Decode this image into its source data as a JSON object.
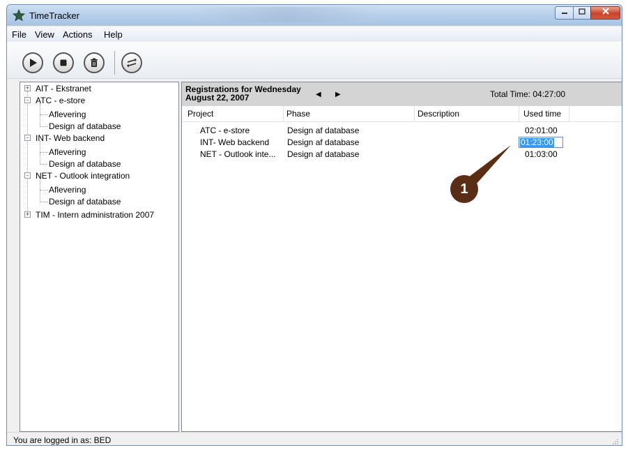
{
  "window": {
    "title": "TimeTracker"
  },
  "menu": [
    {
      "label": "File"
    },
    {
      "label": "View"
    },
    {
      "label": "Actions"
    },
    {
      "label": "Help"
    }
  ],
  "toolbar": {
    "icons": [
      "play-icon",
      "stop-icon",
      "trash-icon",
      "swap-arrows-icon"
    ]
  },
  "tree": {
    "items": [
      {
        "label": "AIT  - Ekstranet",
        "level": 0,
        "expander": "+"
      },
      {
        "label": "ATC - e-store",
        "level": 0,
        "expander": "-"
      },
      {
        "label": "Aflevering",
        "level": 1
      },
      {
        "label": "Design af database",
        "level": 1
      },
      {
        "label": "INT- Web backend",
        "level": 0,
        "expander": "-"
      },
      {
        "label": "Aflevering",
        "level": 1
      },
      {
        "label": "Design af database",
        "level": 1
      },
      {
        "label": "NET - Outlook integration",
        "level": 0,
        "expander": "-"
      },
      {
        "label": "Aflevering",
        "level": 1
      },
      {
        "label": "Design af database",
        "level": 1
      },
      {
        "label": "TIM - Intern administration 2007",
        "level": 0,
        "expander": "+"
      }
    ]
  },
  "registrations": {
    "title_line1": "Registrations for Wednesday",
    "title_line2": "August 22, 2007",
    "prev_arrow": "◀",
    "next_arrow": "▶",
    "total_time": "Total Time: 04:27:00",
    "columns": [
      "Project",
      "Phase",
      "Description",
      "Used time"
    ],
    "rows": [
      {
        "project": "ATC - e-store",
        "phase": "Design af database",
        "description": "",
        "used_time": "02:01:00"
      },
      {
        "project": "INT- Web backend",
        "phase": "Design af database",
        "description": "",
        "used_time": "01:23:00"
      },
      {
        "project": "NET - Outlook inte...",
        "phase": "Design af database",
        "description": "",
        "used_time": "01:03:00"
      }
    ]
  },
  "callout": {
    "number": "1",
    "color": "#5a2e14"
  },
  "status": {
    "text": "You are logged in as: BED"
  }
}
